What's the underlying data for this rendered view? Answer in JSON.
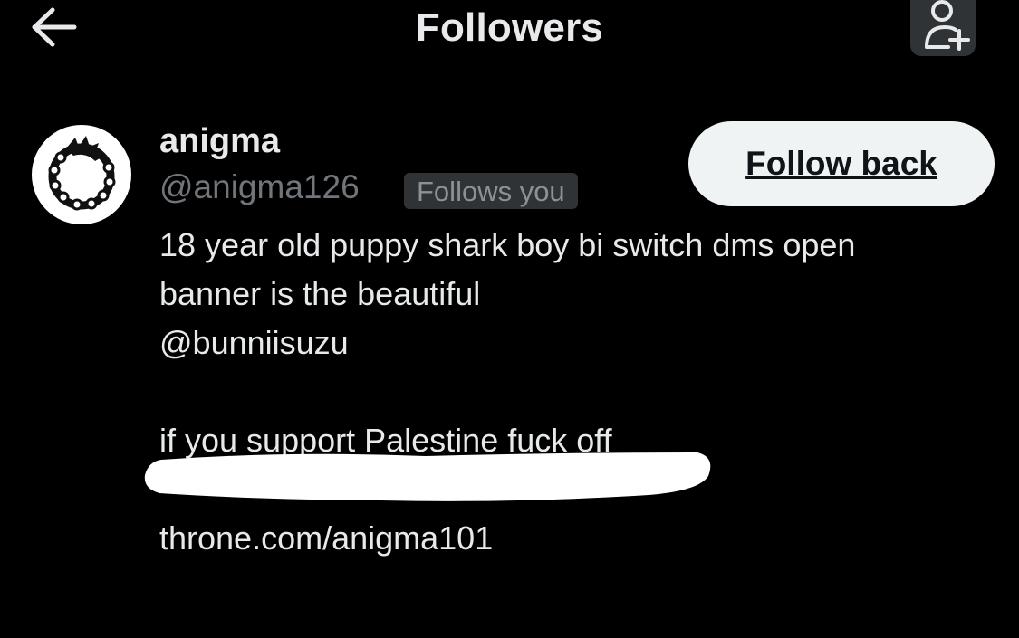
{
  "header": {
    "title": "Followers",
    "back_icon": "arrow-left-icon",
    "add_icon": "person-plus-icon"
  },
  "follower": {
    "display_name": "anigma",
    "handle": "@anigma126",
    "follows_badge": "Follows you",
    "follow_back_label": "Follow back",
    "avatar_icon": "ouroboros-emblem-icon",
    "bio": {
      "line1": "18 year old puppy shark boy bi switch dms open",
      "line2": "banner is the beautiful",
      "mention": "@bunniisuzu",
      "line4": "if you support Palestine fuck off",
      "link": "throne.com/anigma101"
    }
  },
  "colors": {
    "background": "#000000",
    "text_primary": "#e7e9ea",
    "text_secondary": "#71767b",
    "badge_bg": "#2f3336",
    "button_bg": "#eff3f4",
    "button_text": "#0f1419"
  }
}
